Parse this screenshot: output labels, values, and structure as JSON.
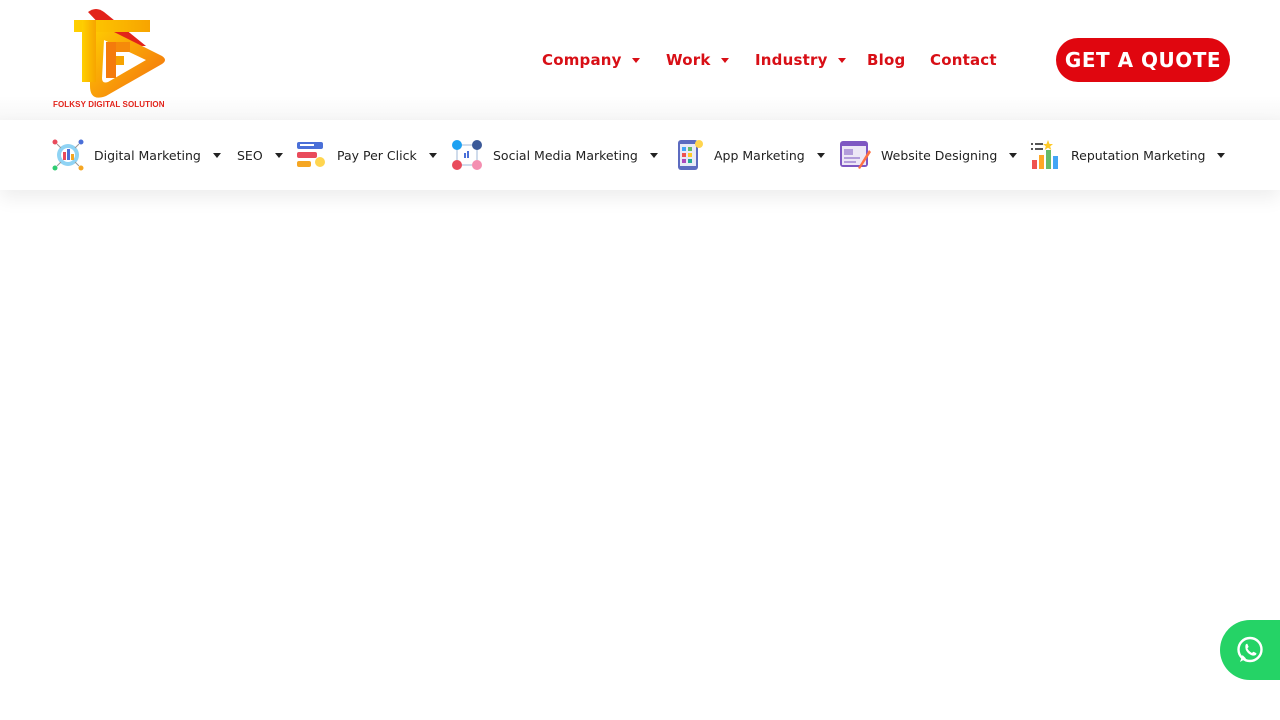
{
  "brand": {
    "name": "FOLKSY DIGITAL SOLUTION",
    "primary_color": "#e0060f"
  },
  "nav": {
    "items": [
      {
        "label": "Company",
        "dropdown": true
      },
      {
        "label": "Work",
        "dropdown": true
      },
      {
        "label": "Industry",
        "dropdown": true
      },
      {
        "label": "Blog",
        "dropdown": false
      },
      {
        "label": "Contact",
        "dropdown": false
      }
    ],
    "cta_label": "GET A QUOTE"
  },
  "services": [
    {
      "label": "Digital Marketing",
      "icon": "digital-marketing-icon"
    },
    {
      "label": "SEO",
      "icon": ""
    },
    {
      "label": "Pay Per Click",
      "icon": "pay-per-click-icon"
    },
    {
      "label": "Social Media Marketing",
      "icon": "social-media-icon"
    },
    {
      "label": "App Marketing",
      "icon": "mobile-app-icon"
    },
    {
      "label": "Website Designing",
      "icon": "website-design-icon"
    },
    {
      "label": "Reputation Marketing",
      "icon": "reputation-chart-icon"
    }
  ],
  "whatsapp": {
    "icon": "whatsapp-icon",
    "color": "#25d366"
  }
}
